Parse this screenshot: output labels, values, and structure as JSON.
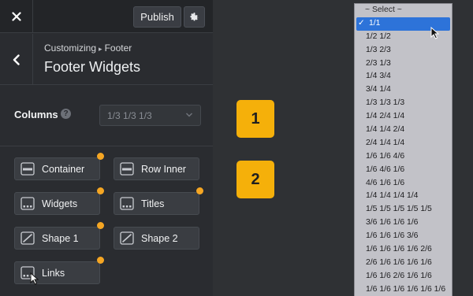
{
  "topbar": {
    "publish_label": "Publish"
  },
  "header": {
    "breadcrumb_parent": "Customizing",
    "breadcrumb_separator": "▸",
    "breadcrumb_current": "Footer",
    "title": "Footer Widgets"
  },
  "columns": {
    "label": "Columns",
    "help": "?",
    "selected_value": "1/3 1/3 1/3"
  },
  "widgets": [
    {
      "label": "Container",
      "icon": "container-icon"
    },
    {
      "label": "Row Inner",
      "icon": "row-inner-icon"
    },
    {
      "label": "Widgets",
      "icon": "widgets-icon"
    },
    {
      "label": "Titles",
      "icon": "titles-icon"
    },
    {
      "label": "Shape 1",
      "icon": "shape-icon"
    },
    {
      "label": "Shape 2",
      "icon": "shape-icon"
    },
    {
      "label": "Links",
      "icon": "links-icon"
    }
  ],
  "callouts": [
    "1",
    "2"
  ],
  "dropdown": {
    "placeholder": "~ Select ~",
    "selected": "1/1",
    "options": [
      "1/1",
      "1/2 1/2",
      "1/3 2/3",
      "2/3 1/3",
      "1/4 3/4",
      "3/4 1/4",
      "1/3 1/3 1/3",
      "1/4 2/4 1/4",
      "1/4 1/4 2/4",
      "2/4 1/4 1/4",
      "1/6 1/6 4/6",
      "1/6 4/6 1/6",
      "4/6 1/6 1/6",
      "1/4 1/4 1/4 1/4",
      "1/5 1/5 1/5 1/5 1/5",
      "3/6 1/6 1/6 1/6",
      "1/6 1/6 1/6 3/6",
      "1/6 1/6 1/6 1/6 2/6",
      "2/6 1/6 1/6 1/6 1/6",
      "1/6 1/6 2/6 1/6 1/6",
      "1/6 1/6 1/6 1/6 1/6 1/6"
    ]
  },
  "colors": {
    "accent": "#f5a623",
    "callout": "#f5b00a",
    "selection": "#2d73d9"
  }
}
